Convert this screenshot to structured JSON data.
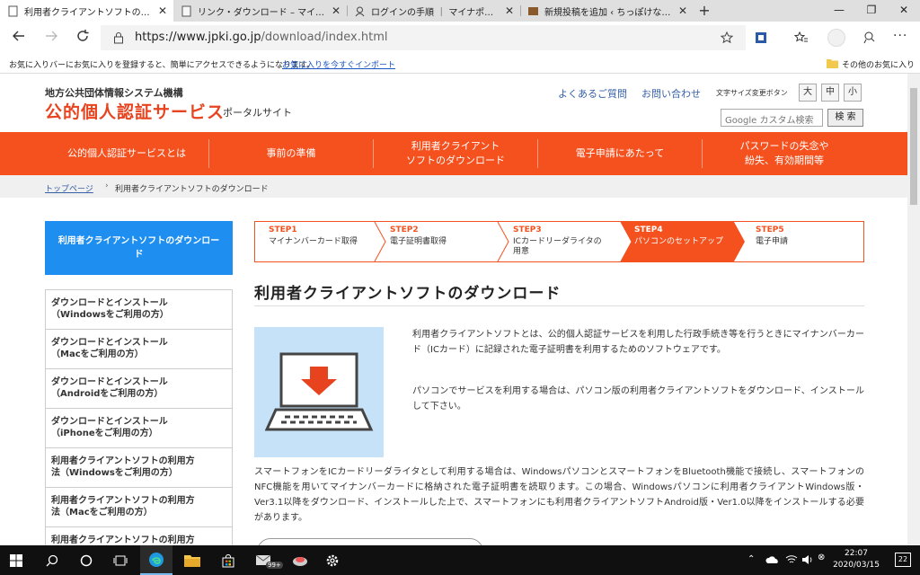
{
  "browser": {
    "tabs": [
      {
        "title": "利用者クライアントソフトのダウンロー|",
        "active": true
      },
      {
        "title": "リンク・ダウンロード – マイナンバーカー|",
        "active": false
      },
      {
        "title": "ログインの手順 ｜ マイナポータル",
        "active": false
      },
      {
        "title": "新規投稿を追加 ‹ ちっぽけな機械好",
        "active": false
      }
    ],
    "new_tab": "+",
    "close_glyph": "✕",
    "url_prefix": "https://www.jpki.go.jp",
    "url_path": "/download/index.html",
    "favbar_text": "お気に入りバーにお気に入りを登録すると、簡単にアクセスできるようになります。",
    "favbar_link": "お気に入りを今すぐインポート",
    "favbar_other": "その他のお気に入り",
    "accent": "#f4511e"
  },
  "header": {
    "org": "地方公共団体情報システム機構",
    "brand": "公的個人認証サービス",
    "portal": "ポータルサイト",
    "faq": "よくあるご質問",
    "contact": "お問い合わせ",
    "font_size_label": "文字サイズ変更ボタン",
    "font_sizes": [
      "大",
      "中",
      "小"
    ],
    "search_placeholder": "Google カスタム検索",
    "search_button": "検 索"
  },
  "nav": [
    "公的個人認証サービスとは",
    "事前の準備",
    "利用者クライアント\nソフトのダウンロード",
    "電子申請にあたって",
    "パスワードの失念や\n紛失、有効期間等"
  ],
  "breadcrumb": {
    "home": "トップページ",
    "sep": "›",
    "current": "利用者クライアントソフトのダウンロード"
  },
  "sidebar": {
    "heading": "利用者クライアントソフトのダウンロード",
    "items": [
      {
        "line1": "ダウンロードとインストール",
        "line2": "（Windowsをご利用の方）"
      },
      {
        "line1": "ダウンロードとインストール",
        "line2": "（Macをご利用の方）"
      },
      {
        "line1": "ダウンロードとインストール",
        "line2": "（Androidをご利用の方）"
      },
      {
        "line1": "ダウンロードとインストール",
        "line2": "（iPhoneをご利用の方）"
      },
      {
        "line1": "利用者クライアントソフトの利用方",
        "line2": "法（Windowsをご利用の方）"
      },
      {
        "line1": "利用者クライアントソフトの利用方",
        "line2": "法（Macをご利用の方）"
      },
      {
        "line1": "利用者クライアントソフトの利用方",
        "line2": ""
      }
    ]
  },
  "steps": [
    {
      "num": "STEP1",
      "desc": "マイナンバーカード取得",
      "active": false
    },
    {
      "num": "STEP2",
      "desc": "電子証明書取得",
      "active": false
    },
    {
      "num": "STEP3",
      "desc": "ICカードリーダライタの\n用意",
      "active": false
    },
    {
      "num": "STEP4",
      "desc": "パソコンのセットアップ",
      "active": true
    },
    {
      "num": "STEP5",
      "desc": "電子申請",
      "active": false
    }
  ],
  "content": {
    "title": "利用者クライアントソフトのダウンロード",
    "p1": "利用者クライアントソフトとは、公的個人認証サービスを利用した行政手続き等を行うときにマイナンバーカード（ICカード）に記録された電子証明書を利用するためのソフトウェアです。",
    "p2": "パソコンでサービスを利用する場合は、パソコン版の利用者クライアントソフトをダウンロード、インストールして下さい。",
    "p3": "スマートフォンをICカードリーダライタとして利用する場合は、WindowsパソコンとスマートフォンをBluetooth機能で接続し、スマートフォンのNFC機能を用いてマイナンバーカードに格納された電子証明書を読取ります。この場合、Windowsパソコンに利用者クライアントWindows版・Ver3.1以降をダウンロード、インストールした上で、スマートフォンにも利用者クライアントソフトAndroid版・Ver1.0以降をインストールする必要があります。"
  },
  "taskbar": {
    "time": "22:07",
    "date": "2020/03/15",
    "badge": "99+",
    "notif": "22"
  }
}
